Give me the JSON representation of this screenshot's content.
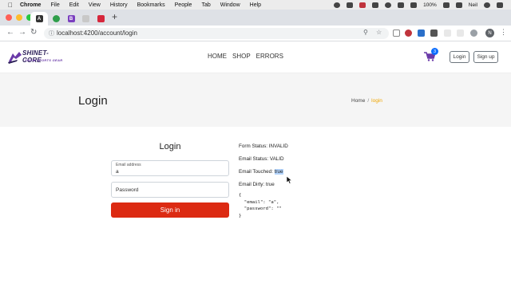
{
  "menubar": {
    "app": "Chrome",
    "menus": [
      "File",
      "Edit",
      "View",
      "History",
      "Bookmarks",
      "People",
      "Tab",
      "Window",
      "Help"
    ],
    "battery": "100%",
    "clock": "Neil"
  },
  "browser": {
    "url": "localhost:4200/account/login"
  },
  "site": {
    "nav_links": [
      "HOME",
      "SHOP",
      "ERRORS"
    ],
    "cart_count": "3",
    "login_button": "Login",
    "signup_button": "Sign up",
    "logo_title": "SHINET-CORE",
    "logo_tagline": "SNOW SPORTS GEAR"
  },
  "header": {
    "title": "Login",
    "breadcrumb_home": "Home",
    "breadcrumb_sep": "/",
    "breadcrumb_current": "login"
  },
  "form": {
    "title": "Login",
    "email_label": "Email address",
    "email_value": "a",
    "password_placeholder": "Password",
    "submit_label": "Sign in"
  },
  "status": {
    "form_status": "Form Status: INVALID",
    "email_status": "Email Status: VALID",
    "email_touched_label": "Email Touched: ",
    "email_touched_value": "true",
    "email_dirty": "Email Dirty: true",
    "json_value": "{\n  \"email\": \"a\",\n  \"password\": \"\"\n}"
  },
  "colors": {
    "accent_red": "#dc2a12",
    "breadcrumb_active": "#f0a500",
    "badge_blue": "#0d6efd"
  }
}
